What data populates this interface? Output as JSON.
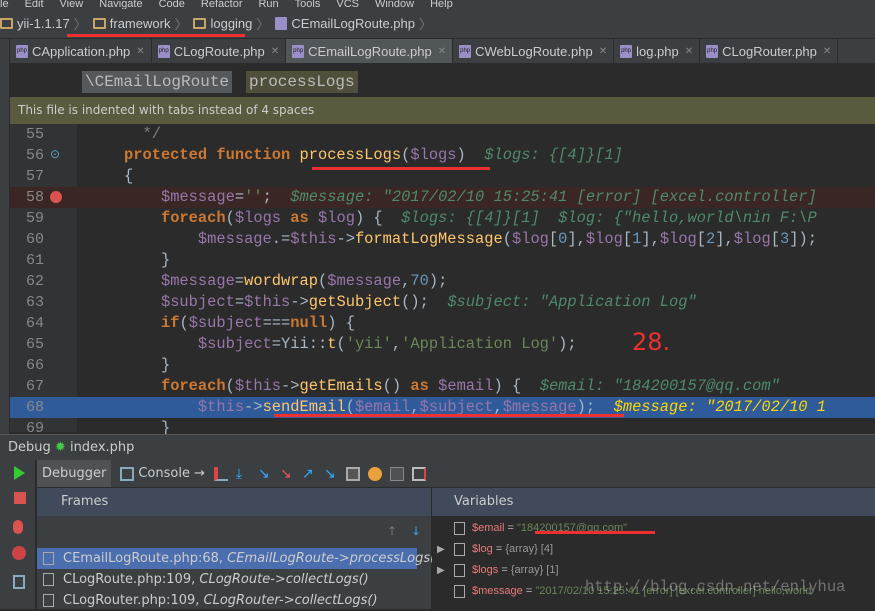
{
  "menu": [
    "le",
    "Edit",
    "View",
    "Navigate",
    "Code",
    "Refactor",
    "Run",
    "Tools",
    "VCS",
    "Window",
    "Help"
  ],
  "breadcrumb": [
    {
      "label": "yii-1.1.17",
      "icon": "folder-icon"
    },
    {
      "label": "framework",
      "icon": "folder-icon"
    },
    {
      "label": "logging",
      "icon": "folder-icon"
    },
    {
      "label": "CEmailLogRoute.php",
      "icon": "php-file-icon"
    }
  ],
  "tabs": [
    {
      "label": "CApplication.php"
    },
    {
      "label": "CLogRoute.php"
    },
    {
      "label": "CEmailLogRoute.php",
      "active": true
    },
    {
      "label": "CWebLogRoute.php"
    },
    {
      "label": "log.php"
    },
    {
      "label": "CLogRouter.php"
    }
  ],
  "nav": {
    "class": "\\CEmailLogRoute",
    "method": "processLogs"
  },
  "notice": "This file is indented with tabs instead of 4 spaces",
  "code": [
    {
      "n": "55",
      "t": [
        [
          "cm",
          "  */"
        ]
      ]
    },
    {
      "n": "56",
      "t": [
        [
          "kw",
          "protected function "
        ],
        [
          "fn",
          "processLogs"
        ],
        [
          "pl",
          "("
        ],
        [
          "var",
          "$logs"
        ],
        [
          "pl",
          ")  "
        ],
        [
          "hint",
          "$logs: {[4]}[1]"
        ]
      ]
    },
    {
      "n": "57",
      "t": [
        [
          "pl",
          "{"
        ]
      ]
    },
    {
      "n": "58",
      "bp": true,
      "t": [
        [
          "pl",
          "    "
        ],
        [
          "var",
          "$message"
        ],
        [
          "pl",
          "="
        ],
        [
          "str",
          "''"
        ],
        [
          "pl",
          ";  "
        ],
        [
          "hint",
          "$message: \"2017/02/10 15:25:41 [error] [excel.controller]"
        ]
      ]
    },
    {
      "n": "59",
      "t": [
        [
          "pl",
          "    "
        ],
        [
          "kw",
          "foreach"
        ],
        [
          "pl",
          "("
        ],
        [
          "var",
          "$logs"
        ],
        [
          "kw",
          " as "
        ],
        [
          "var",
          "$log"
        ],
        [
          "pl",
          ") {  "
        ],
        [
          "hint",
          "$logs: {[4]}[1]  $log: {\"hello,world\\nin F:\\P"
        ]
      ]
    },
    {
      "n": "60",
      "t": [
        [
          "pl",
          "        "
        ],
        [
          "var",
          "$message"
        ],
        [
          "pl",
          ".="
        ],
        [
          "var",
          "$this"
        ],
        [
          "pl",
          "->"
        ],
        [
          "fn",
          "formatLogMessage"
        ],
        [
          "pl",
          "("
        ],
        [
          "var",
          "$log"
        ],
        [
          "pl",
          "["
        ],
        [
          "num",
          "0"
        ],
        [
          "pl",
          "],"
        ],
        [
          "var",
          "$log"
        ],
        [
          "pl",
          "["
        ],
        [
          "num",
          "1"
        ],
        [
          "pl",
          "],"
        ],
        [
          "var",
          "$log"
        ],
        [
          "pl",
          "["
        ],
        [
          "num",
          "2"
        ],
        [
          "pl",
          "],"
        ],
        [
          "var",
          "$log"
        ],
        [
          "pl",
          "["
        ],
        [
          "num",
          "3"
        ],
        [
          "pl",
          "]);"
        ]
      ]
    },
    {
      "n": "61",
      "t": [
        [
          "pl",
          "    }"
        ]
      ]
    },
    {
      "n": "62",
      "t": [
        [
          "pl",
          "    "
        ],
        [
          "var",
          "$message"
        ],
        [
          "pl",
          "="
        ],
        [
          "fn",
          "wordwrap"
        ],
        [
          "pl",
          "("
        ],
        [
          "var",
          "$message"
        ],
        [
          "pl",
          ","
        ],
        [
          "num",
          "70"
        ],
        [
          "pl",
          ");"
        ]
      ]
    },
    {
      "n": "63",
      "t": [
        [
          "pl",
          "    "
        ],
        [
          "var",
          "$subject"
        ],
        [
          "pl",
          "="
        ],
        [
          "var",
          "$this"
        ],
        [
          "pl",
          "->"
        ],
        [
          "fn",
          "getSubject"
        ],
        [
          "pl",
          "();  "
        ],
        [
          "hint",
          "$subject: \"Application Log\""
        ]
      ]
    },
    {
      "n": "64",
      "t": [
        [
          "pl",
          "    "
        ],
        [
          "kw",
          "if"
        ],
        [
          "pl",
          "("
        ],
        [
          "var",
          "$subject"
        ],
        [
          "pl",
          "==="
        ],
        [
          "kw",
          "null"
        ],
        [
          "pl",
          ") {"
        ]
      ]
    },
    {
      "n": "65",
      "t": [
        [
          "pl",
          "        "
        ],
        [
          "var",
          "$subject"
        ],
        [
          "pl",
          "=Yii::"
        ],
        [
          "fn",
          "t"
        ],
        [
          "pl",
          "("
        ],
        [
          "str",
          "'yii'"
        ],
        [
          "pl",
          ","
        ],
        [
          "str",
          "'Application Log'"
        ],
        [
          "pl",
          ");"
        ]
      ]
    },
    {
      "n": "66",
      "t": [
        [
          "pl",
          "    }"
        ]
      ]
    },
    {
      "n": "67",
      "t": [
        [
          "pl",
          "    "
        ],
        [
          "kw",
          "foreach"
        ],
        [
          "pl",
          "("
        ],
        [
          "var",
          "$this"
        ],
        [
          "pl",
          "->"
        ],
        [
          "fn",
          "getEmails"
        ],
        [
          "pl",
          "()"
        ],
        [
          "kw",
          " as "
        ],
        [
          "var",
          "$email"
        ],
        [
          "pl",
          ") {  "
        ],
        [
          "hint",
          "$email: \"184200157@qq.com\""
        ]
      ]
    },
    {
      "n": "68",
      "exec": true,
      "t": [
        [
          "pl",
          "        "
        ],
        [
          "var",
          "$this"
        ],
        [
          "pl",
          "->"
        ],
        [
          "fn",
          "sendEmail"
        ],
        [
          "pl",
          "("
        ],
        [
          "var",
          "$email"
        ],
        [
          "pl",
          ","
        ],
        [
          "var",
          "$subject"
        ],
        [
          "pl",
          ","
        ],
        [
          "var",
          "$message"
        ],
        [
          "pl",
          ");  "
        ],
        [
          "hinty",
          "$message: \"2017/02/10 1"
        ]
      ]
    },
    {
      "n": "69",
      "t": [
        [
          "pl",
          "    }"
        ]
      ]
    }
  ],
  "annotation": "28.",
  "debug": {
    "title": "Debug",
    "config": "index.php",
    "tab_debugger": "Debugger",
    "tab_console": "Console",
    "frames_label": "Frames",
    "variables_label": "Variables"
  },
  "frames": [
    {
      "file": "CEmailLogRoute.php:68,",
      "method": "CEmailLogRoute->processLogs()",
      "selected": true
    },
    {
      "file": "CLogRoute.php:109,",
      "method": "CLogRoute->collectLogs()"
    },
    {
      "file": "CLogRouter.php:109,",
      "method": "CLogRouter->collectLogs()"
    }
  ],
  "variables": [
    {
      "name": "$email",
      "eq": " = ",
      "value": "\"184200157@qq.com\"",
      "type": ""
    },
    {
      "name": "$log",
      "eq": " = ",
      "value": "",
      "type": "{array} [4]",
      "expandable": true
    },
    {
      "name": "$logs",
      "eq": " = ",
      "value": "",
      "type": "{array} [1]",
      "expandable": true
    },
    {
      "name": "$message",
      "eq": " = ",
      "value": "\"2017/02/10 15:25:41 [error] [excel.controller] hello,world",
      "type": ""
    }
  ],
  "watermark": "http://blog.csdn.net/enlyhua",
  "colors": {
    "annotation_red": "#f03030",
    "exec_line": "#2f5b9a",
    "selected_frame": "#4b6eaf"
  }
}
